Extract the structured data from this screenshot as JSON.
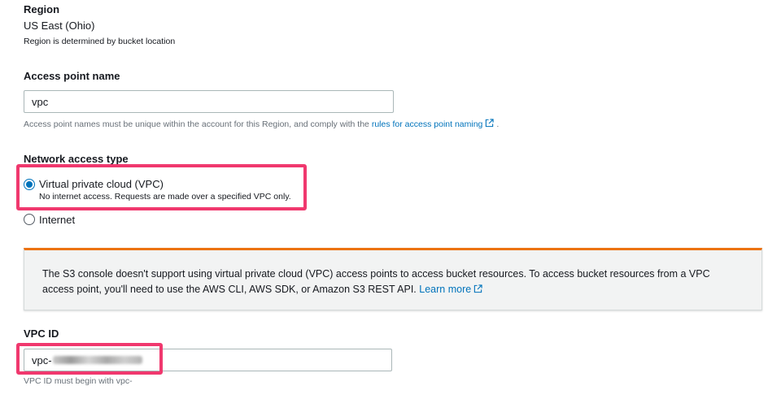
{
  "region": {
    "label": "Region",
    "value": "US East (Ohio)",
    "help": "Region is determined by bucket location"
  },
  "access_point": {
    "label": "Access point name",
    "value": "vpc",
    "help_prefix": "Access point names must be unique within the account for this Region, and comply with the ",
    "help_link": "rules for access point naming",
    "help_suffix": " ."
  },
  "network": {
    "label": "Network access type",
    "options": [
      {
        "label": "Virtual private cloud (VPC)",
        "description": "No internet access. Requests are made over a specified VPC only.",
        "selected": true
      },
      {
        "label": "Internet",
        "selected": false
      }
    ]
  },
  "alert": {
    "text": "The S3 console doesn't support using virtual private cloud (VPC) access points to access bucket resources. To access bucket resources from a VPC access point, you'll need to use the AWS CLI, AWS SDK, or Amazon S3 REST API. ",
    "link": "Learn more"
  },
  "vpc_id": {
    "label": "VPC ID",
    "value_prefix": "vpc-",
    "help": "VPC ID must begin with vpc-"
  },
  "colors": {
    "link": "#0073bb",
    "highlight": "#f0386e",
    "alert_accent": "#ec7211"
  }
}
